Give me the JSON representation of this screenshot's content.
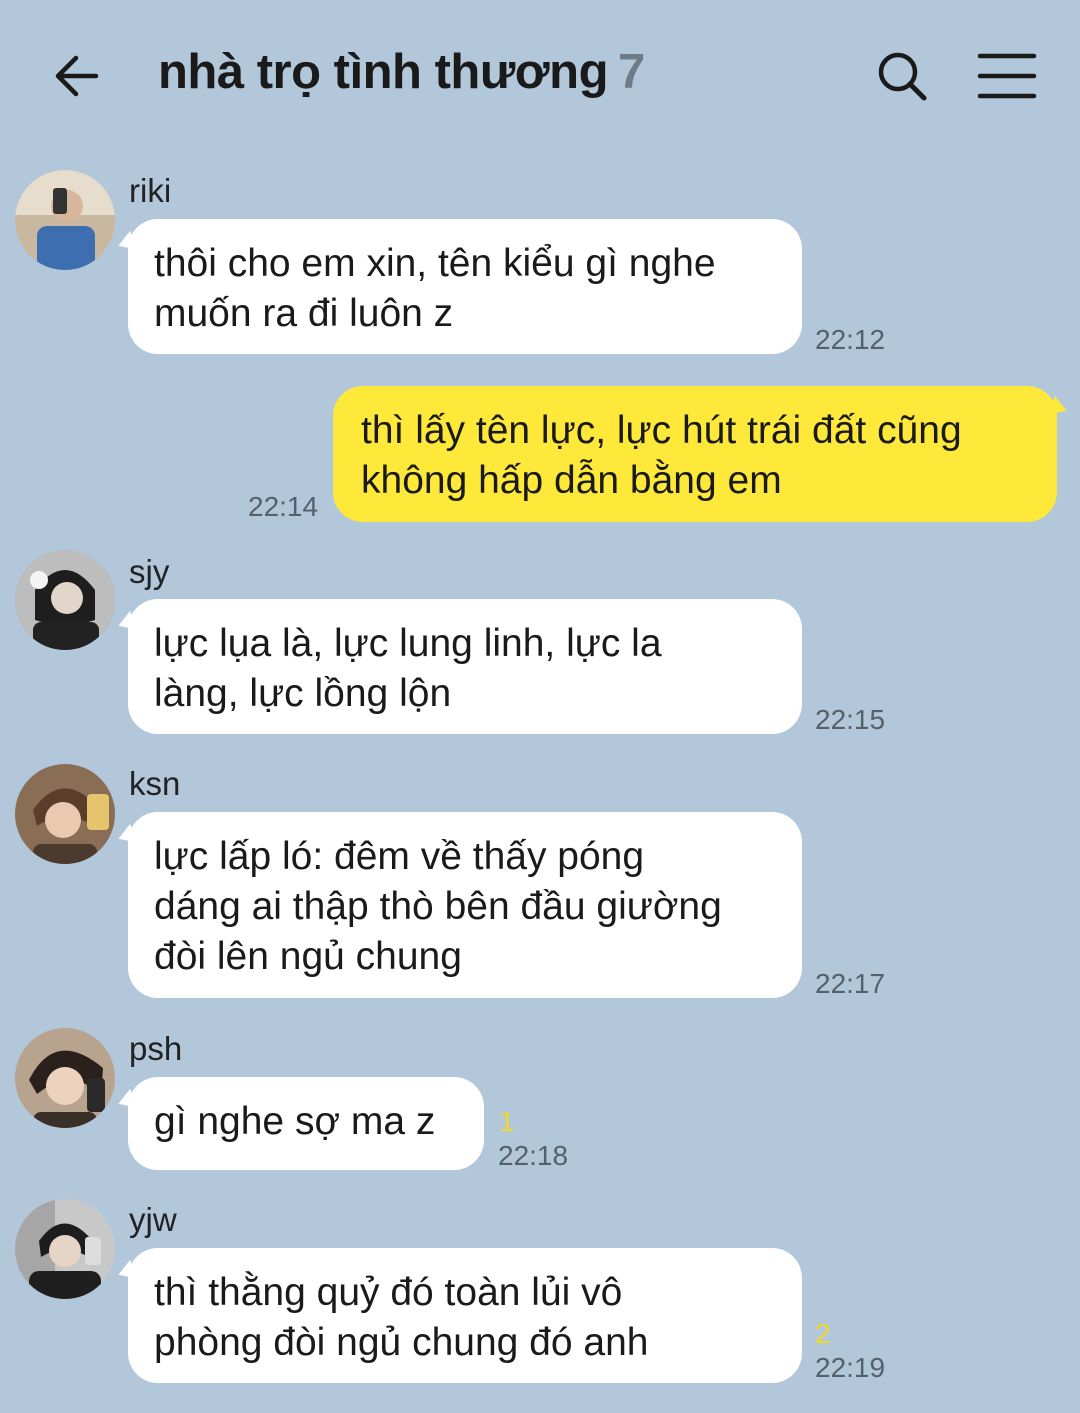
{
  "header": {
    "title": "nhà trọ tình thương",
    "member_count": "7",
    "back_icon": "arrow-left-icon",
    "search_icon": "search-icon",
    "menu_icon": "hamburger-menu-icon"
  },
  "colors": {
    "background": "#b2c7da",
    "incoming_bubble": "#ffffff",
    "outgoing_bubble": "#fee93a",
    "unread_count": "#efd92a"
  },
  "messages": [
    {
      "sender": "riki",
      "text": "thôi cho em xin, tên kiểu gì nghe\nmuốn ra đi luôn z",
      "time": "22:12",
      "unread": ""
    },
    {
      "sender": "",
      "text": "thì lấy tên lực, lực hút trái đất cũng\nkhông hấp dẫn bằng em",
      "time": "22:14",
      "unread": ""
    },
    {
      "sender": "sjy",
      "text": "lực lụa là, lực lung linh, lực la\nlàng, lực lồng lộn",
      "time": "22:15",
      "unread": ""
    },
    {
      "sender": "ksn",
      "text": "lực lấp ló: đêm về thấy póng\ndáng ai thập thò bên đầu giường\nđòi lên ngủ chung",
      "time": "22:17",
      "unread": ""
    },
    {
      "sender": "psh",
      "text": "gì nghe sợ ma z",
      "time": "22:18",
      "unread": "1"
    },
    {
      "sender": "yjw",
      "text": "thì thằng quỷ đó toàn lủi vô\nphòng đòi ngủ chung đó anh",
      "time": "22:19",
      "unread": "2"
    }
  ]
}
